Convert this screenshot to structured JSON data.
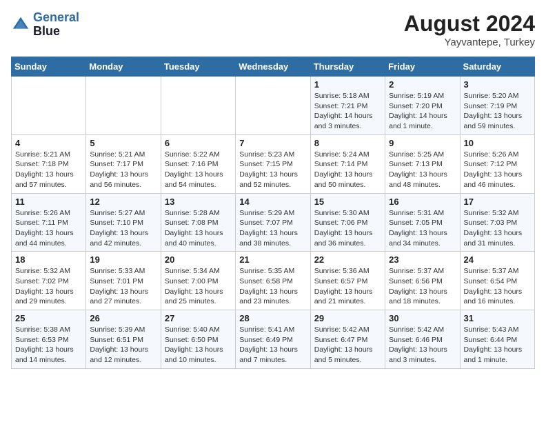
{
  "header": {
    "logo_line1": "General",
    "logo_line2": "Blue",
    "month": "August 2024",
    "location": "Yayvantepe, Turkey"
  },
  "columns": [
    "Sunday",
    "Monday",
    "Tuesday",
    "Wednesday",
    "Thursday",
    "Friday",
    "Saturday"
  ],
  "weeks": [
    [
      {
        "day": "",
        "info": ""
      },
      {
        "day": "",
        "info": ""
      },
      {
        "day": "",
        "info": ""
      },
      {
        "day": "",
        "info": ""
      },
      {
        "day": "1",
        "info": "Sunrise: 5:18 AM\nSunset: 7:21 PM\nDaylight: 14 hours\nand 3 minutes."
      },
      {
        "day": "2",
        "info": "Sunrise: 5:19 AM\nSunset: 7:20 PM\nDaylight: 14 hours\nand 1 minute."
      },
      {
        "day": "3",
        "info": "Sunrise: 5:20 AM\nSunset: 7:19 PM\nDaylight: 13 hours\nand 59 minutes."
      }
    ],
    [
      {
        "day": "4",
        "info": "Sunrise: 5:21 AM\nSunset: 7:18 PM\nDaylight: 13 hours\nand 57 minutes."
      },
      {
        "day": "5",
        "info": "Sunrise: 5:21 AM\nSunset: 7:17 PM\nDaylight: 13 hours\nand 56 minutes."
      },
      {
        "day": "6",
        "info": "Sunrise: 5:22 AM\nSunset: 7:16 PM\nDaylight: 13 hours\nand 54 minutes."
      },
      {
        "day": "7",
        "info": "Sunrise: 5:23 AM\nSunset: 7:15 PM\nDaylight: 13 hours\nand 52 minutes."
      },
      {
        "day": "8",
        "info": "Sunrise: 5:24 AM\nSunset: 7:14 PM\nDaylight: 13 hours\nand 50 minutes."
      },
      {
        "day": "9",
        "info": "Sunrise: 5:25 AM\nSunset: 7:13 PM\nDaylight: 13 hours\nand 48 minutes."
      },
      {
        "day": "10",
        "info": "Sunrise: 5:26 AM\nSunset: 7:12 PM\nDaylight: 13 hours\nand 46 minutes."
      }
    ],
    [
      {
        "day": "11",
        "info": "Sunrise: 5:26 AM\nSunset: 7:11 PM\nDaylight: 13 hours\nand 44 minutes."
      },
      {
        "day": "12",
        "info": "Sunrise: 5:27 AM\nSunset: 7:10 PM\nDaylight: 13 hours\nand 42 minutes."
      },
      {
        "day": "13",
        "info": "Sunrise: 5:28 AM\nSunset: 7:08 PM\nDaylight: 13 hours\nand 40 minutes."
      },
      {
        "day": "14",
        "info": "Sunrise: 5:29 AM\nSunset: 7:07 PM\nDaylight: 13 hours\nand 38 minutes."
      },
      {
        "day": "15",
        "info": "Sunrise: 5:30 AM\nSunset: 7:06 PM\nDaylight: 13 hours\nand 36 minutes."
      },
      {
        "day": "16",
        "info": "Sunrise: 5:31 AM\nSunset: 7:05 PM\nDaylight: 13 hours\nand 34 minutes."
      },
      {
        "day": "17",
        "info": "Sunrise: 5:32 AM\nSunset: 7:03 PM\nDaylight: 13 hours\nand 31 minutes."
      }
    ],
    [
      {
        "day": "18",
        "info": "Sunrise: 5:32 AM\nSunset: 7:02 PM\nDaylight: 13 hours\nand 29 minutes."
      },
      {
        "day": "19",
        "info": "Sunrise: 5:33 AM\nSunset: 7:01 PM\nDaylight: 13 hours\nand 27 minutes."
      },
      {
        "day": "20",
        "info": "Sunrise: 5:34 AM\nSunset: 7:00 PM\nDaylight: 13 hours\nand 25 minutes."
      },
      {
        "day": "21",
        "info": "Sunrise: 5:35 AM\nSunset: 6:58 PM\nDaylight: 13 hours\nand 23 minutes."
      },
      {
        "day": "22",
        "info": "Sunrise: 5:36 AM\nSunset: 6:57 PM\nDaylight: 13 hours\nand 21 minutes."
      },
      {
        "day": "23",
        "info": "Sunrise: 5:37 AM\nSunset: 6:56 PM\nDaylight: 13 hours\nand 18 minutes."
      },
      {
        "day": "24",
        "info": "Sunrise: 5:37 AM\nSunset: 6:54 PM\nDaylight: 13 hours\nand 16 minutes."
      }
    ],
    [
      {
        "day": "25",
        "info": "Sunrise: 5:38 AM\nSunset: 6:53 PM\nDaylight: 13 hours\nand 14 minutes."
      },
      {
        "day": "26",
        "info": "Sunrise: 5:39 AM\nSunset: 6:51 PM\nDaylight: 13 hours\nand 12 minutes."
      },
      {
        "day": "27",
        "info": "Sunrise: 5:40 AM\nSunset: 6:50 PM\nDaylight: 13 hours\nand 10 minutes."
      },
      {
        "day": "28",
        "info": "Sunrise: 5:41 AM\nSunset: 6:49 PM\nDaylight: 13 hours\nand 7 minutes."
      },
      {
        "day": "29",
        "info": "Sunrise: 5:42 AM\nSunset: 6:47 PM\nDaylight: 13 hours\nand 5 minutes."
      },
      {
        "day": "30",
        "info": "Sunrise: 5:42 AM\nSunset: 6:46 PM\nDaylight: 13 hours\nand 3 minutes."
      },
      {
        "day": "31",
        "info": "Sunrise: 5:43 AM\nSunset: 6:44 PM\nDaylight: 13 hours\nand 1 minute."
      }
    ]
  ]
}
